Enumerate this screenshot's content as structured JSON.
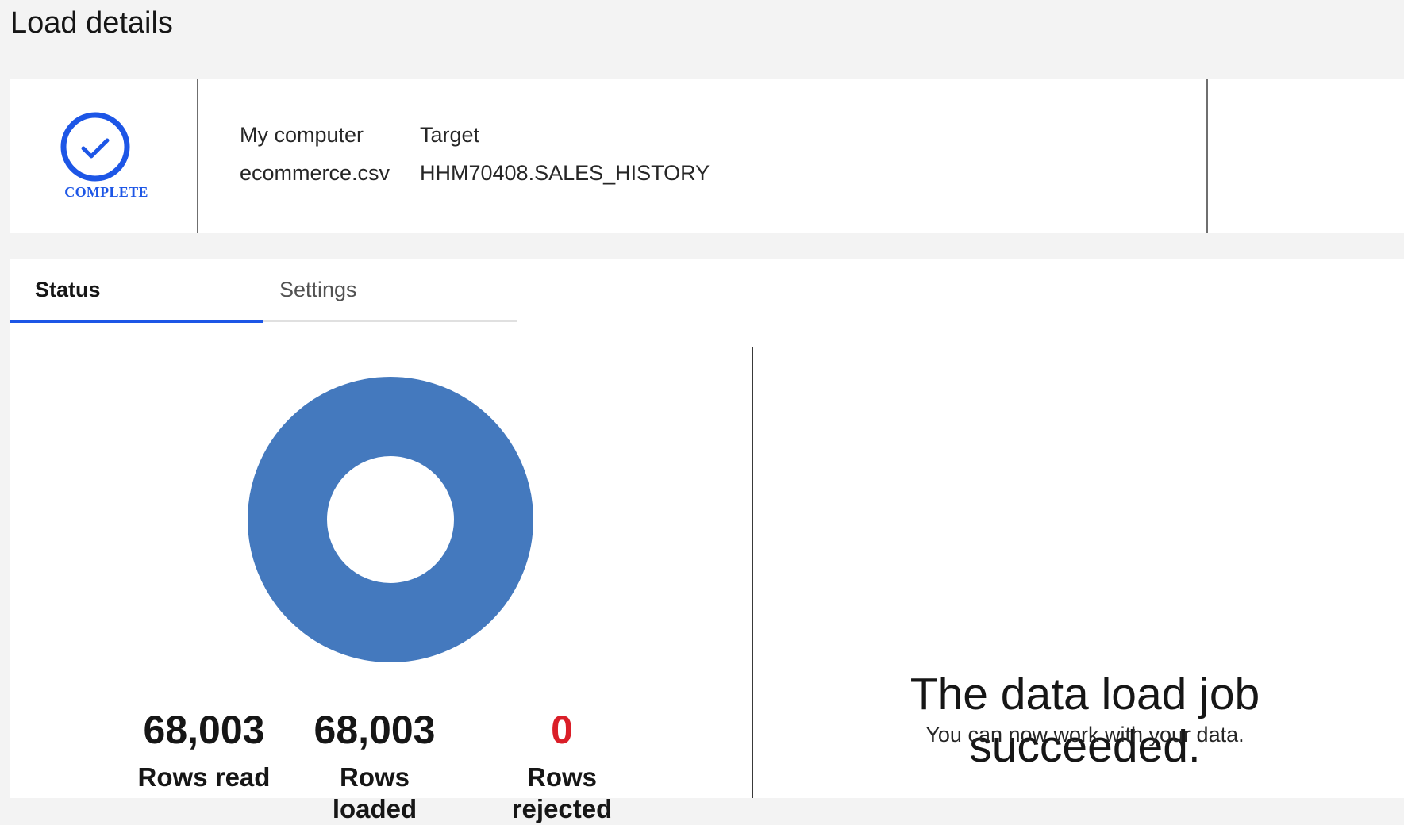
{
  "page": {
    "title": "Load details"
  },
  "summary": {
    "status": "COMPLETE",
    "source": {
      "label": "My computer",
      "value": "ecommerce.csv"
    },
    "target": {
      "label": "Target",
      "value": "HHM70408.SALES_HISTORY"
    }
  },
  "tabs": [
    {
      "label": "Status",
      "active": true
    },
    {
      "label": "Settings",
      "active": false
    }
  ],
  "chart_data": {
    "type": "pie",
    "categories": [
      "Rows loaded",
      "Rows rejected"
    ],
    "values": [
      68003,
      0
    ],
    "colors": [
      "#4479be",
      "#da1e28"
    ]
  },
  "metrics": {
    "read": {
      "value": "68,003",
      "label": "Rows read"
    },
    "loaded": {
      "value": "68,003",
      "label": "Rows loaded"
    },
    "rejected": {
      "value": "0",
      "label": "Rows rejected"
    }
  },
  "result": {
    "title": "The data load job succeeded.",
    "subtitle": "You can now work with your data."
  },
  "colors": {
    "accent": "#1d56e6",
    "donut": "#4479be",
    "rejected": "#da1e28"
  }
}
